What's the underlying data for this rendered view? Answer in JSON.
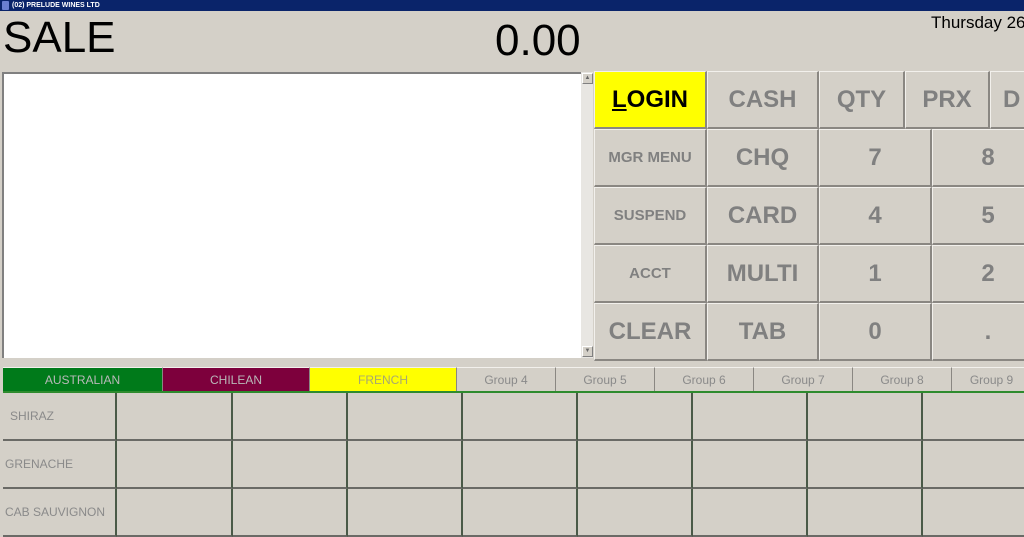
{
  "window": {
    "title": "(02) PRELUDE WINES LTD"
  },
  "header": {
    "mode": "SALE",
    "total": "0.00",
    "date": "Thursday 26"
  },
  "colors": {
    "titlebar": "#0a246a",
    "login_bg": "#ffff00",
    "australian": "#007a1a",
    "chilean": "#7d003c",
    "french": "#ffff00",
    "group_line": "#2e8b2e"
  },
  "keypad": {
    "row1": [
      "LOGIN",
      "CASH",
      "QTY",
      "PRX",
      "D"
    ],
    "row2": [
      "MGR MENU",
      "CHQ",
      "7",
      "8"
    ],
    "row3": [
      "SUSPEND",
      "CARD",
      "4",
      "5"
    ],
    "row4": [
      "ACCT",
      "MULTI",
      "1",
      "2"
    ],
    "row5": [
      "CLEAR",
      "TAB",
      "0",
      "."
    ]
  },
  "groups": [
    "AUSTRALIAN",
    "CHILEAN",
    "FRENCH",
    "Group 4",
    "Group 5",
    "Group 6",
    "Group 7",
    "Group 8",
    "Group 9"
  ],
  "products": {
    "rows": [
      "SHIRAZ",
      "GRENACHE",
      "CAB SAUVIGNON"
    ]
  }
}
